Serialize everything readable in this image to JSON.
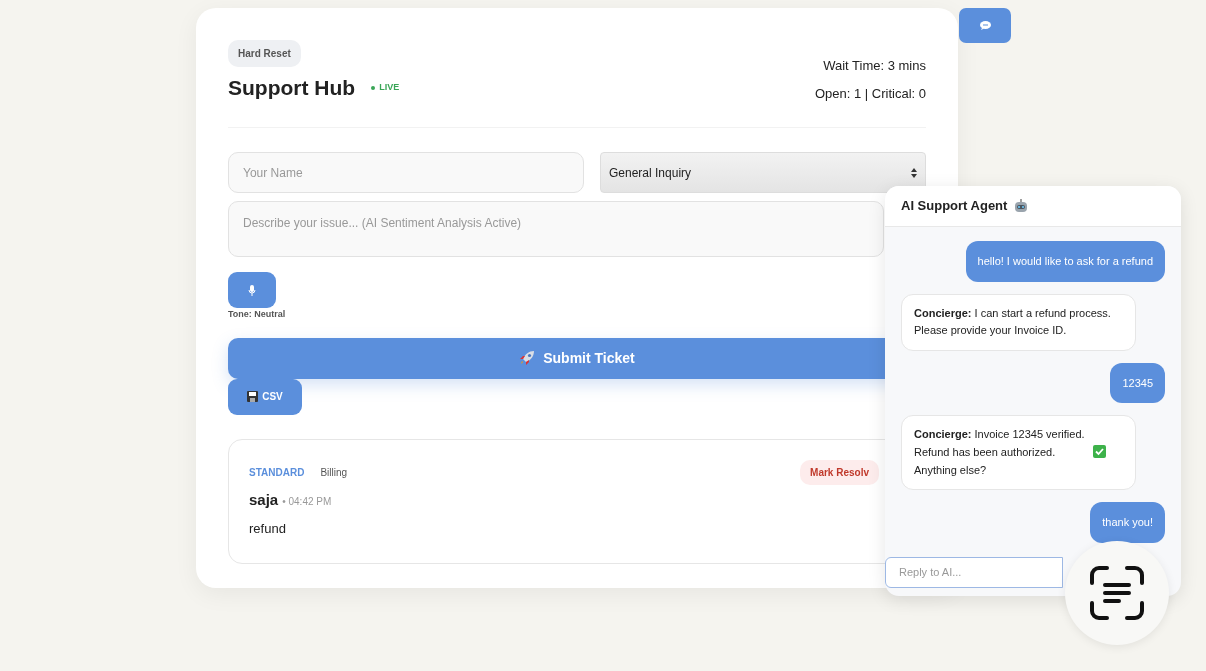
{
  "header": {
    "reset_button": "Hard Reset",
    "title": "Support Hub",
    "status": "LIVE",
    "wait_time": "Wait Time: 3 mins",
    "counts": "Open: 1 | Critical: 0"
  },
  "form": {
    "name_placeholder": "Your Name",
    "category": "General Inquiry",
    "description_placeholder": "Describe your issue... (AI Sentiment Analysis Active)",
    "tone": "Tone: Neutral",
    "submit": "Submit Ticket",
    "export": "CSV"
  },
  "tickets": [
    {
      "priority": "STANDARD",
      "category": "Billing",
      "name": "saja",
      "time": "• 04:42 PM",
      "message": "refund",
      "action": "Mark Resolv"
    }
  ],
  "chat": {
    "title": "AI Support Agent",
    "messages": [
      {
        "kind": "user",
        "text": "hello! I would like to ask for a refund"
      },
      {
        "kind": "agent",
        "sender": "Concierge:",
        "text": "I can start a refund process. Please provide your Invoice ID."
      },
      {
        "kind": "user",
        "text": "12345"
      },
      {
        "kind": "agent",
        "sender": "Concierge:",
        "text": "Invoice 12345 verified. Refund has been authorized.",
        "text_after_check": "Anything else?"
      },
      {
        "kind": "user",
        "text": "thank you!"
      }
    ],
    "reply_placeholder": "Reply to AI..."
  }
}
